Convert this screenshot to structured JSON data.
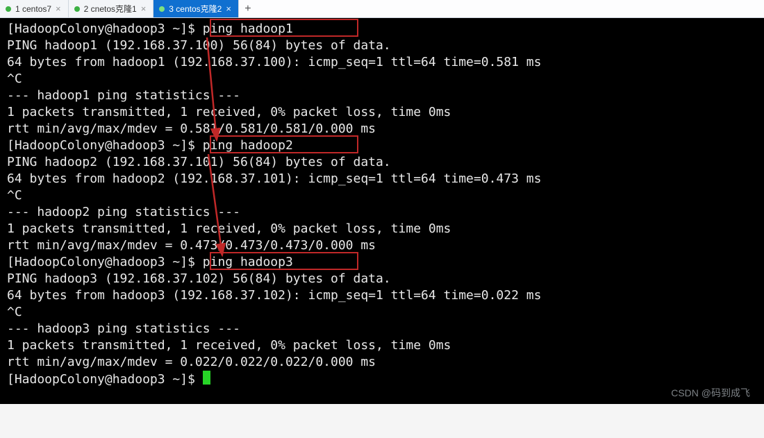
{
  "tabs": [
    {
      "label": "1 centos7",
      "active": false
    },
    {
      "label": "2 cnetos克隆1",
      "active": false
    },
    {
      "label": "3 centos克隆2",
      "active": true
    }
  ],
  "term": {
    "prompt": "[HadoopColony@hadoop3 ~]$ ",
    "cmd1": "ping hadoop1",
    "l1": "PING hadoop1 (192.168.37.100) 56(84) bytes of data.",
    "l2": "64 bytes from hadoop1 (192.168.37.100): icmp_seq=1 ttl=64 time=0.581 ms",
    "ctrl": "^C",
    "s1a": "--- hadoop1 ping statistics ---",
    "s1b": "1 packets transmitted, 1 received, 0% packet loss, time 0ms",
    "s1c": "rtt min/avg/max/mdev = 0.581/0.581/0.581/0.000 ms",
    "cmd2": "ping hadoop2",
    "l3": "PING hadoop2 (192.168.37.101) 56(84) bytes of data.",
    "l4": "64 bytes from hadoop2 (192.168.37.101): icmp_seq=1 ttl=64 time=0.473 ms",
    "s2a": "--- hadoop2 ping statistics ---",
    "s2b": "1 packets transmitted, 1 received, 0% packet loss, time 0ms",
    "s2c": "rtt min/avg/max/mdev = 0.473/0.473/0.473/0.000 ms",
    "cmd3": "ping hadoop3",
    "l5": "PING hadoop3 (192.168.37.102) 56(84) bytes of data.",
    "l6": "64 bytes from hadoop3 (192.168.37.102): icmp_seq=1 ttl=64 time=0.022 ms",
    "s3a": "--- hadoop3 ping statistics ---",
    "s3b": "1 packets transmitted, 1 received, 0% packet loss, time 0ms",
    "s3c": "rtt min/avg/max/mdev = 0.022/0.022/0.022/0.000 ms"
  },
  "watermark": "CSDN @码到成飞"
}
